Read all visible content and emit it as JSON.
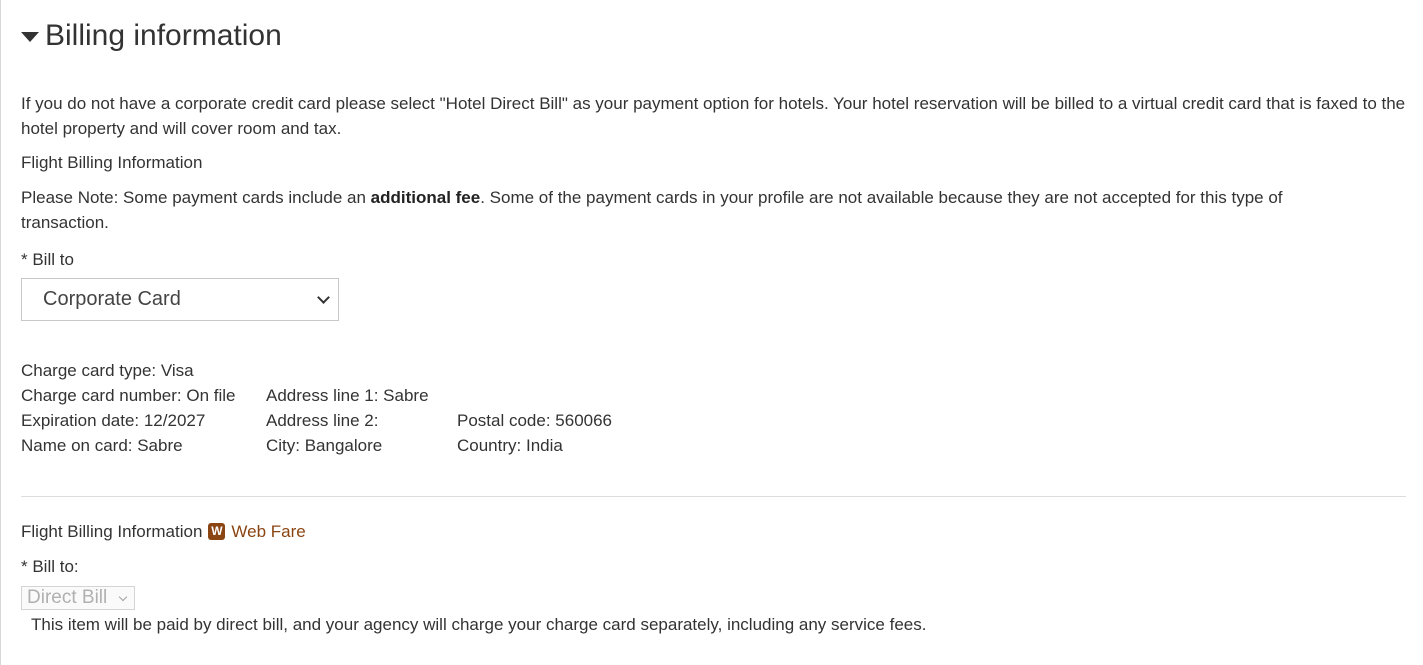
{
  "section": {
    "title": "Billing information"
  },
  "intro_text": "If you do not have a corporate credit card please select \"Hotel Direct Bill\" as your payment option for hotels. Your hotel reservation will be billed to a virtual credit card that is faxed to the hotel property and will cover room and tax.",
  "flight_billing_1": {
    "heading": "Flight Billing Information",
    "note_prefix": "Please Note: Some payment cards include an ",
    "note_bold": "additional fee",
    "note_suffix": ". Some of the payment cards in your profile are not available because they are not accepted for this type of transaction.",
    "bill_to_label": "* Bill to",
    "bill_to_selected": "Corporate Card"
  },
  "card_details": {
    "card_type": "Charge card type: Visa",
    "card_number": "Charge card number: On file",
    "expiration": "Expiration date: 12/2027",
    "name_on_card": "Name on card: Sabre",
    "address_line1": "Address line 1: Sabre",
    "address_line2": "Address line 2:",
    "city": "City: Bangalore",
    "postal_code": "Postal code: 560066",
    "country": "Country: India"
  },
  "flight_billing_2": {
    "heading": "Flight Billing Information",
    "badge": "W",
    "web_fare_label": "Web Fare",
    "bill_to_label": "* Bill to:",
    "bill_to_selected": "Direct Bill",
    "direct_bill_note": "This item will be paid by direct bill, and your agency will charge your charge card separately, including any service fees."
  },
  "colors": {
    "text": "#333333",
    "web_fare": "#8b4513",
    "divider": "#dddddd"
  }
}
